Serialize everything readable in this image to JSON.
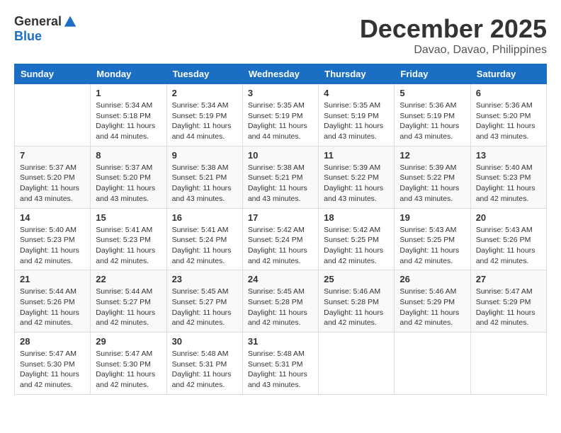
{
  "logo": {
    "general": "General",
    "blue": "Blue"
  },
  "title": "December 2025",
  "subtitle": "Davao, Davao, Philippines",
  "days": [
    "Sunday",
    "Monday",
    "Tuesday",
    "Wednesday",
    "Thursday",
    "Friday",
    "Saturday"
  ],
  "weeks": [
    [
      {
        "day": "",
        "sunrise": "",
        "sunset": "",
        "daylight": ""
      },
      {
        "day": "1",
        "sunrise": "Sunrise: 5:34 AM",
        "sunset": "Sunset: 5:18 PM",
        "daylight": "Daylight: 11 hours and 44 minutes."
      },
      {
        "day": "2",
        "sunrise": "Sunrise: 5:34 AM",
        "sunset": "Sunset: 5:19 PM",
        "daylight": "Daylight: 11 hours and 44 minutes."
      },
      {
        "day": "3",
        "sunrise": "Sunrise: 5:35 AM",
        "sunset": "Sunset: 5:19 PM",
        "daylight": "Daylight: 11 hours and 44 minutes."
      },
      {
        "day": "4",
        "sunrise": "Sunrise: 5:35 AM",
        "sunset": "Sunset: 5:19 PM",
        "daylight": "Daylight: 11 hours and 43 minutes."
      },
      {
        "day": "5",
        "sunrise": "Sunrise: 5:36 AM",
        "sunset": "Sunset: 5:19 PM",
        "daylight": "Daylight: 11 hours and 43 minutes."
      },
      {
        "day": "6",
        "sunrise": "Sunrise: 5:36 AM",
        "sunset": "Sunset: 5:20 PM",
        "daylight": "Daylight: 11 hours and 43 minutes."
      }
    ],
    [
      {
        "day": "7",
        "sunrise": "Sunrise: 5:37 AM",
        "sunset": "Sunset: 5:20 PM",
        "daylight": "Daylight: 11 hours and 43 minutes."
      },
      {
        "day": "8",
        "sunrise": "Sunrise: 5:37 AM",
        "sunset": "Sunset: 5:20 PM",
        "daylight": "Daylight: 11 hours and 43 minutes."
      },
      {
        "day": "9",
        "sunrise": "Sunrise: 5:38 AM",
        "sunset": "Sunset: 5:21 PM",
        "daylight": "Daylight: 11 hours and 43 minutes."
      },
      {
        "day": "10",
        "sunrise": "Sunrise: 5:38 AM",
        "sunset": "Sunset: 5:21 PM",
        "daylight": "Daylight: 11 hours and 43 minutes."
      },
      {
        "day": "11",
        "sunrise": "Sunrise: 5:39 AM",
        "sunset": "Sunset: 5:22 PM",
        "daylight": "Daylight: 11 hours and 43 minutes."
      },
      {
        "day": "12",
        "sunrise": "Sunrise: 5:39 AM",
        "sunset": "Sunset: 5:22 PM",
        "daylight": "Daylight: 11 hours and 43 minutes."
      },
      {
        "day": "13",
        "sunrise": "Sunrise: 5:40 AM",
        "sunset": "Sunset: 5:23 PM",
        "daylight": "Daylight: 11 hours and 42 minutes."
      }
    ],
    [
      {
        "day": "14",
        "sunrise": "Sunrise: 5:40 AM",
        "sunset": "Sunset: 5:23 PM",
        "daylight": "Daylight: 11 hours and 42 minutes."
      },
      {
        "day": "15",
        "sunrise": "Sunrise: 5:41 AM",
        "sunset": "Sunset: 5:23 PM",
        "daylight": "Daylight: 11 hours and 42 minutes."
      },
      {
        "day": "16",
        "sunrise": "Sunrise: 5:41 AM",
        "sunset": "Sunset: 5:24 PM",
        "daylight": "Daylight: 11 hours and 42 minutes."
      },
      {
        "day": "17",
        "sunrise": "Sunrise: 5:42 AM",
        "sunset": "Sunset: 5:24 PM",
        "daylight": "Daylight: 11 hours and 42 minutes."
      },
      {
        "day": "18",
        "sunrise": "Sunrise: 5:42 AM",
        "sunset": "Sunset: 5:25 PM",
        "daylight": "Daylight: 11 hours and 42 minutes."
      },
      {
        "day": "19",
        "sunrise": "Sunrise: 5:43 AM",
        "sunset": "Sunset: 5:25 PM",
        "daylight": "Daylight: 11 hours and 42 minutes."
      },
      {
        "day": "20",
        "sunrise": "Sunrise: 5:43 AM",
        "sunset": "Sunset: 5:26 PM",
        "daylight": "Daylight: 11 hours and 42 minutes."
      }
    ],
    [
      {
        "day": "21",
        "sunrise": "Sunrise: 5:44 AM",
        "sunset": "Sunset: 5:26 PM",
        "daylight": "Daylight: 11 hours and 42 minutes."
      },
      {
        "day": "22",
        "sunrise": "Sunrise: 5:44 AM",
        "sunset": "Sunset: 5:27 PM",
        "daylight": "Daylight: 11 hours and 42 minutes."
      },
      {
        "day": "23",
        "sunrise": "Sunrise: 5:45 AM",
        "sunset": "Sunset: 5:27 PM",
        "daylight": "Daylight: 11 hours and 42 minutes."
      },
      {
        "day": "24",
        "sunrise": "Sunrise: 5:45 AM",
        "sunset": "Sunset: 5:28 PM",
        "daylight": "Daylight: 11 hours and 42 minutes."
      },
      {
        "day": "25",
        "sunrise": "Sunrise: 5:46 AM",
        "sunset": "Sunset: 5:28 PM",
        "daylight": "Daylight: 11 hours and 42 minutes."
      },
      {
        "day": "26",
        "sunrise": "Sunrise: 5:46 AM",
        "sunset": "Sunset: 5:29 PM",
        "daylight": "Daylight: 11 hours and 42 minutes."
      },
      {
        "day": "27",
        "sunrise": "Sunrise: 5:47 AM",
        "sunset": "Sunset: 5:29 PM",
        "daylight": "Daylight: 11 hours and 42 minutes."
      }
    ],
    [
      {
        "day": "28",
        "sunrise": "Sunrise: 5:47 AM",
        "sunset": "Sunset: 5:30 PM",
        "daylight": "Daylight: 11 hours and 42 minutes."
      },
      {
        "day": "29",
        "sunrise": "Sunrise: 5:47 AM",
        "sunset": "Sunset: 5:30 PM",
        "daylight": "Daylight: 11 hours and 42 minutes."
      },
      {
        "day": "30",
        "sunrise": "Sunrise: 5:48 AM",
        "sunset": "Sunset: 5:31 PM",
        "daylight": "Daylight: 11 hours and 42 minutes."
      },
      {
        "day": "31",
        "sunrise": "Sunrise: 5:48 AM",
        "sunset": "Sunset: 5:31 PM",
        "daylight": "Daylight: 11 hours and 43 minutes."
      },
      {
        "day": "",
        "sunrise": "",
        "sunset": "",
        "daylight": ""
      },
      {
        "day": "",
        "sunrise": "",
        "sunset": "",
        "daylight": ""
      },
      {
        "day": "",
        "sunrise": "",
        "sunset": "",
        "daylight": ""
      }
    ]
  ]
}
